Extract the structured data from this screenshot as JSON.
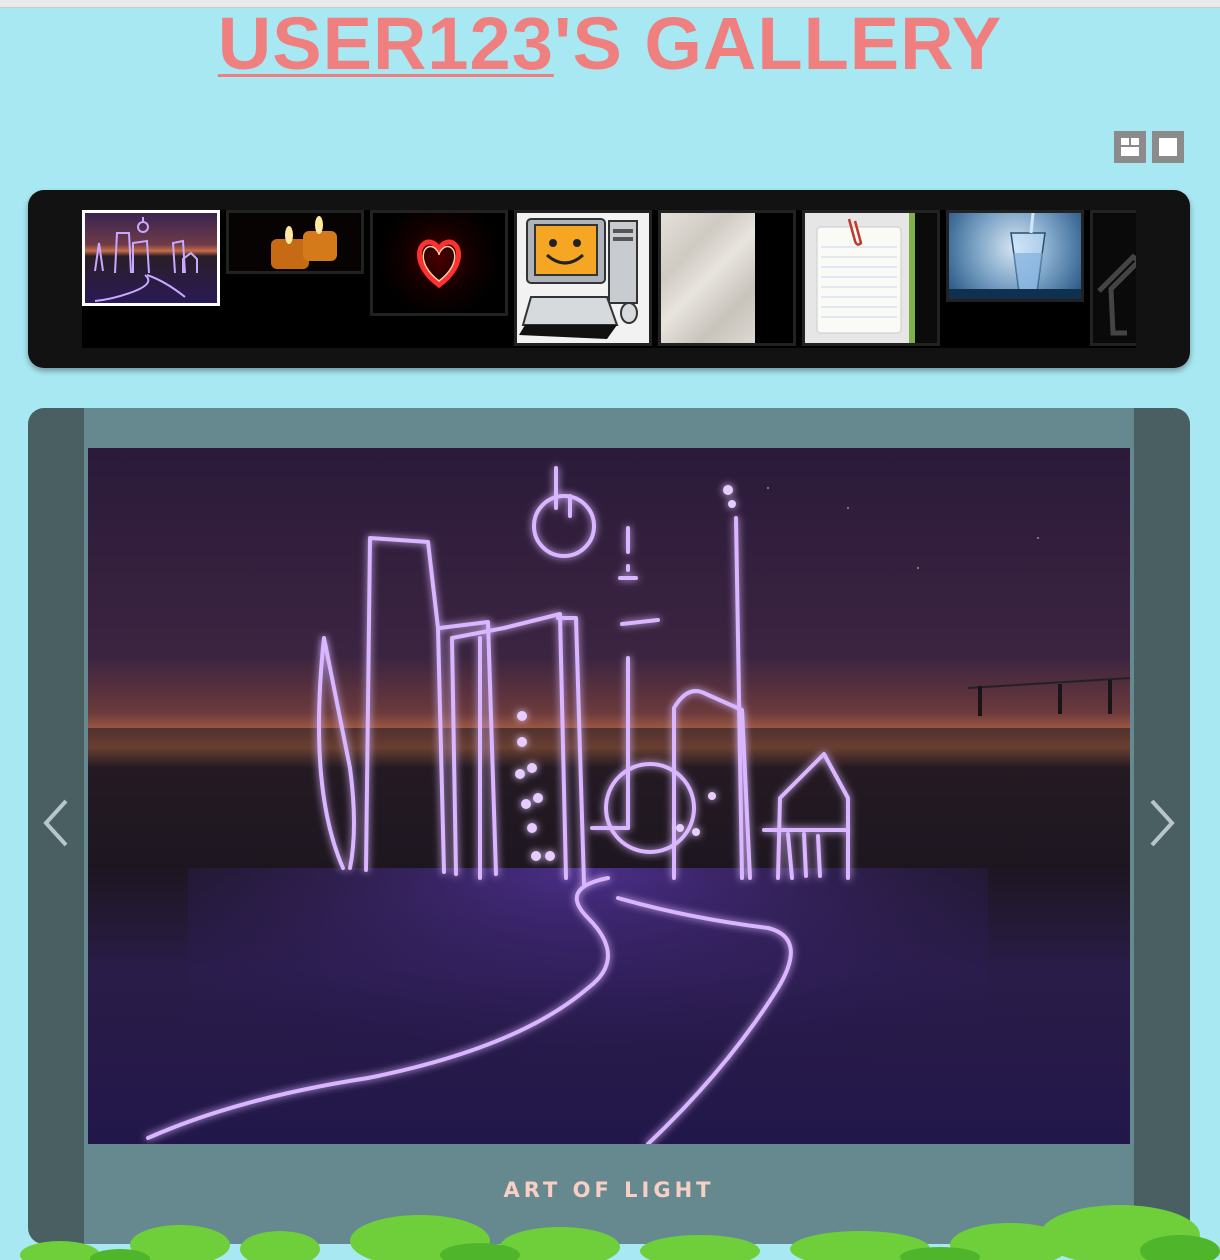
{
  "header": {
    "title_user": "USER123",
    "title_rest": "'S GALLERY"
  },
  "view_toggle": {
    "icons": [
      "grid-view-icon",
      "single-view-icon"
    ]
  },
  "filmstrip": {
    "thumbnails": [
      {
        "subject": "light-drawing-city"
      },
      {
        "subject": "candles"
      },
      {
        "subject": "neon-heart"
      },
      {
        "subject": "smiley-computer"
      },
      {
        "subject": "crumpled-paper"
      },
      {
        "subject": "notepad-paperclip"
      },
      {
        "subject": "glass-of-water"
      },
      {
        "subject": "partial-dark"
      }
    ],
    "active_index": 0
  },
  "viewer": {
    "caption": "ART OF LIGHT",
    "prev_icon": "chevron-left-icon",
    "next_icon": "chevron-right-icon"
  },
  "colors": {
    "background": "#a8e8f2",
    "title": "#f08080",
    "viewer_frame": "#495f62",
    "viewer_panel": "#668990",
    "caption": "#f7cfc4"
  }
}
